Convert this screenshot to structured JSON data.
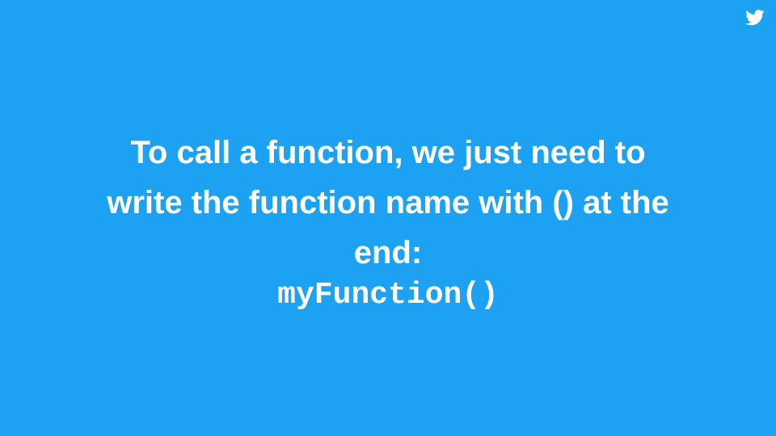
{
  "slide": {
    "text_lines": [
      "To call a function, we just need to",
      "write the function name with () at the",
      "end:"
    ],
    "code": "myFunction()",
    "icon": "twitter-bird-icon",
    "colors": {
      "background": "#1da1f2",
      "text": "#ffffff"
    }
  }
}
